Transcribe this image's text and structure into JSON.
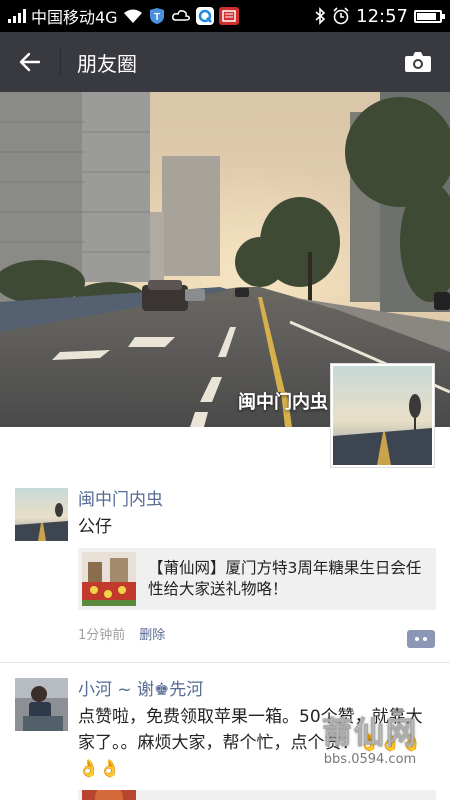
{
  "status_bar": {
    "carrier": "中国移动4G",
    "time": "12:57",
    "icons": [
      "signal-icon",
      "wifi-icon",
      "shield-icon",
      "cloud-icon",
      "qq-icon",
      "news-icon",
      "bluetooth-icon",
      "alarm-icon",
      "battery-icon"
    ],
    "battery_level": 0.85
  },
  "navbar": {
    "title": "朋友圈",
    "back_icon": "back-arrow-icon",
    "camera_icon": "camera-icon",
    "background": "#393a3f"
  },
  "cover": {
    "owner_name": "闽中门内虫"
  },
  "posts": [
    {
      "name": "闽中门内虫",
      "text": "公仔",
      "link_title": "【莆仙网】厦门方特3周年糖果生日会任性给大家送礼物咯！",
      "time": "1分钟前",
      "delete_label": "删除"
    },
    {
      "name": "小河 ~ 谢♚先河",
      "text": "点赞啦，免费领取苹果一箱。50个赞，就靠大家了。。麻烦大家，帮个忙，点个赞！👌👌👌👌👌"
    }
  ],
  "watermark": {
    "main": "莆仙网",
    "url": "bbs.0594.com"
  },
  "colors": {
    "link": "#576b95",
    "comment_button": "#8c97b5"
  }
}
